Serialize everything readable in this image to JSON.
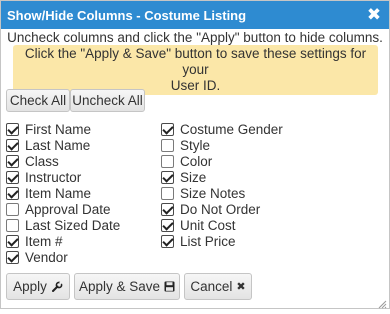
{
  "dialog": {
    "title": "Show/Hide Columns - Costume Listing",
    "close_icon": "close-icon"
  },
  "instructions": "Uncheck columns and click the \"Apply\" button to hide columns.",
  "note": {
    "line1": "Click the \"Apply & Save\" button to save these settings for your",
    "line2": "User ID.",
    "background": "#fbe7a8"
  },
  "toolbar": {
    "check_all": "Check All",
    "uncheck_all": "Uncheck All"
  },
  "columns_left": [
    {
      "label": "First Name",
      "checked": true
    },
    {
      "label": "Last Name",
      "checked": true
    },
    {
      "label": "Class",
      "checked": true
    },
    {
      "label": "Instructor",
      "checked": true
    },
    {
      "label": "Item Name",
      "checked": true
    },
    {
      "label": "Approval Date",
      "checked": false
    },
    {
      "label": "Last Sized Date",
      "checked": false
    },
    {
      "label": "Item #",
      "checked": true
    },
    {
      "label": "Vendor",
      "checked": true
    }
  ],
  "columns_right": [
    {
      "label": "Costume Gender",
      "checked": true
    },
    {
      "label": "Style",
      "checked": false
    },
    {
      "label": "Color",
      "checked": false
    },
    {
      "label": "Size",
      "checked": true
    },
    {
      "label": "Size Notes",
      "checked": false
    },
    {
      "label": "Do Not Order",
      "checked": true
    },
    {
      "label": "Unit Cost",
      "checked": true
    },
    {
      "label": "List Price",
      "checked": true
    }
  ],
  "actions": {
    "apply": "Apply",
    "apply_icon": "wrench-icon",
    "apply_save": "Apply & Save",
    "apply_save_icon": "save-icon",
    "cancel": "Cancel",
    "cancel_icon": "close-icon"
  },
  "colors": {
    "titlebar": "#2e8bd1",
    "titlebar_text": "#ffffff"
  }
}
